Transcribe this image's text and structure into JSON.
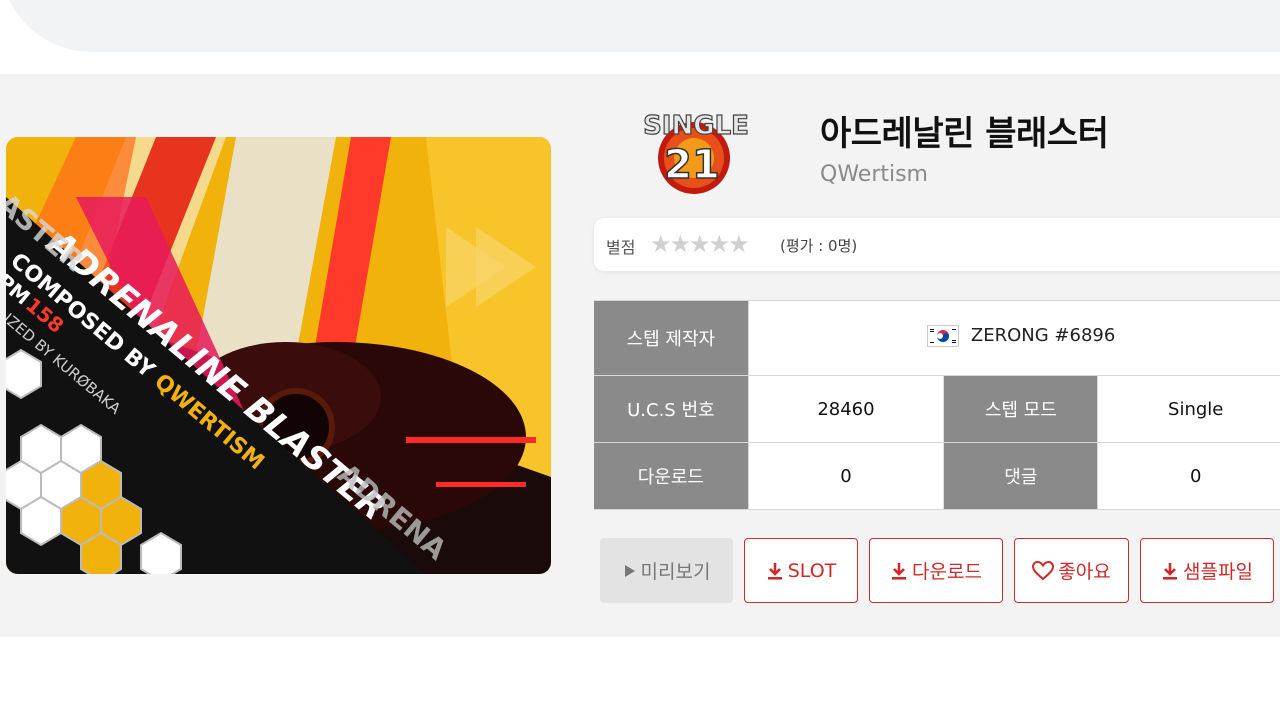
{
  "song": {
    "title": "아드레날린 블래스터",
    "artist": "QWertism",
    "level_badge": {
      "mode": "SINGLE",
      "level": "21"
    }
  },
  "rating": {
    "label": "별점",
    "stars": "★★★★★",
    "count_text": "(평가 : 0명)"
  },
  "info": {
    "step_maker_label": "스텝 제작자",
    "step_maker_value": "ZERONG #6896",
    "ucs_label": "U.C.S 번호",
    "ucs_value": "28460",
    "step_mode_label": "스텝 모드",
    "step_mode_value": "Single",
    "download_label": "다운로드",
    "download_value": "0",
    "comment_label": "댓글",
    "comment_value": "0"
  },
  "actions": {
    "preview": "미리보기",
    "slot": "SLOT",
    "download": "다운로드",
    "like": "좋아요",
    "sample": "샘플파일"
  },
  "cover_art": {
    "title_text": "ADRENALINE BLASTER",
    "composed_text": "COMPOSED BY",
    "composer": "QWERTISM",
    "bpm_label": "BPM",
    "bpm_value": "158",
    "visualized_text": "VISUALIZED BY KURØBAKA",
    "edge_text_left": "ASTER",
    "edge_text_bottom": "ADRENA"
  },
  "colors": {
    "accent": "#cf2a2a",
    "header_cell": "#8a8a8a",
    "panel_bg": "#f3f3f4"
  }
}
